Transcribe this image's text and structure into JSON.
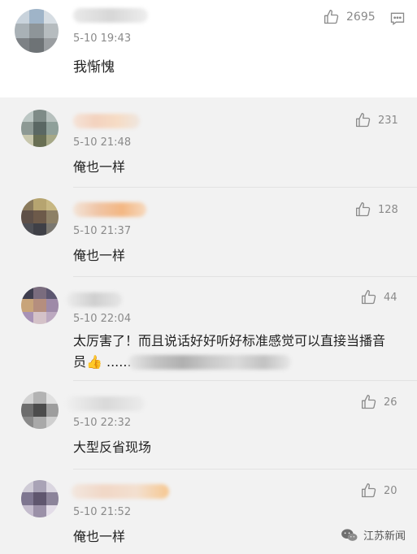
{
  "main_comment": {
    "time": "5-10 19:43",
    "likes": "2695",
    "text": "我惭愧"
  },
  "replies": [
    {
      "time": "5-10 21:48",
      "likes": "231",
      "text": "俺也一样"
    },
    {
      "time": "5-10 21:37",
      "likes": "128",
      "text": "俺也一样"
    },
    {
      "time": "5-10 22:04",
      "likes": "44",
      "text_line1": "太厉害了！而且说话好好听好标准感觉可以直接当播音",
      "text_line2": "员👍 ......"
    },
    {
      "time": "5-10 22:32",
      "likes": "26",
      "text": "大型反省现场"
    },
    {
      "time": "5-10 21:52",
      "likes": "20",
      "text": "俺也一样"
    }
  ],
  "watermark": {
    "label": "江苏新闻"
  },
  "colors": {
    "reply_bg": "#f2f2f2",
    "meta_gray": "#8a8a8a"
  },
  "icons": {
    "like": "thumbs-up-icon",
    "reply": "comment-icon",
    "watermark": "wechat-icon"
  }
}
